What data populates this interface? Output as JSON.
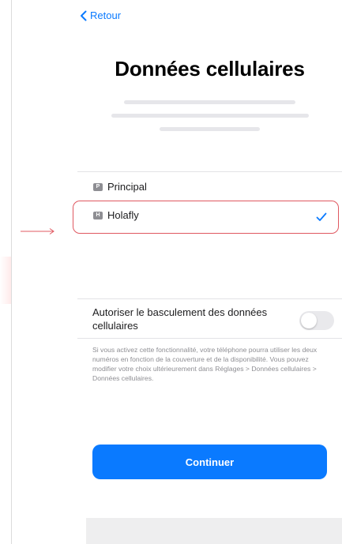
{
  "nav": {
    "back_label": "Retour",
    "back_icon": "chevron-left-icon"
  },
  "page": {
    "title": "Données cellulaires"
  },
  "lines": [
    {
      "badge": "P",
      "label": "Principal",
      "selected": false
    },
    {
      "badge": "H",
      "label": "Holafly",
      "selected": true
    }
  ],
  "toggle": {
    "label": "Autoriser le basculement des données cellulaires",
    "enabled": false
  },
  "help_text": "Si vous activez cette fonctionnalité, votre téléphone pourra utiliser les deux numéros en fonction de la couverture et de la disponibilité. Vous pouvez modifier votre choix ultérieurement dans Réglages > Données cellulaires > Données cellulaires.",
  "actions": {
    "continue_label": "Continuer"
  },
  "colors": {
    "accent": "#0a7aff",
    "highlight": "#e05860",
    "secondary_text": "#8e8e93"
  }
}
